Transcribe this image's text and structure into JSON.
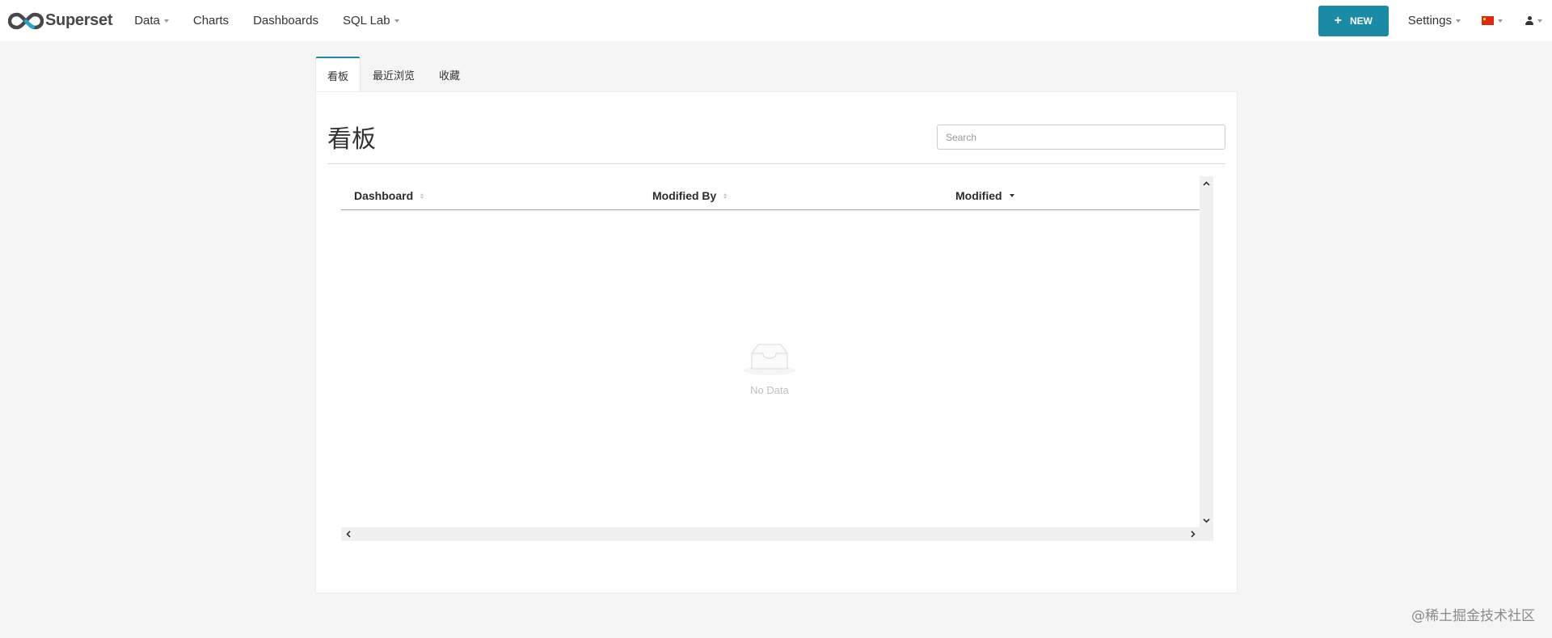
{
  "navbar": {
    "brand": "Superset",
    "items": [
      {
        "label": "Data",
        "has_caret": true
      },
      {
        "label": "Charts",
        "has_caret": false
      },
      {
        "label": "Dashboards",
        "has_caret": false
      },
      {
        "label": "SQL Lab",
        "has_caret": true
      }
    ],
    "new_button": {
      "icon": "plus-icon",
      "label": "NEW"
    },
    "settings_label": "Settings",
    "language_icon": "china-flag-icon",
    "user_icon": "user-icon"
  },
  "tabs": [
    {
      "label": "看板",
      "active": true
    },
    {
      "label": "最近浏览",
      "active": false
    },
    {
      "label": "收藏",
      "active": false
    }
  ],
  "panel": {
    "title": "看板",
    "search_placeholder": "Search",
    "table": {
      "columns": [
        {
          "label": "Dashboard",
          "sort": "none"
        },
        {
          "label": "Modified By",
          "sort": "none"
        },
        {
          "label": "Modified",
          "sort": "desc"
        }
      ],
      "rows": [],
      "empty_text": "No Data"
    }
  },
  "watermark": "@稀土掘金技术社区",
  "colors": {
    "accent": "#1b8aa4",
    "background": "#f5f5f5",
    "panel": "#ffffff"
  }
}
